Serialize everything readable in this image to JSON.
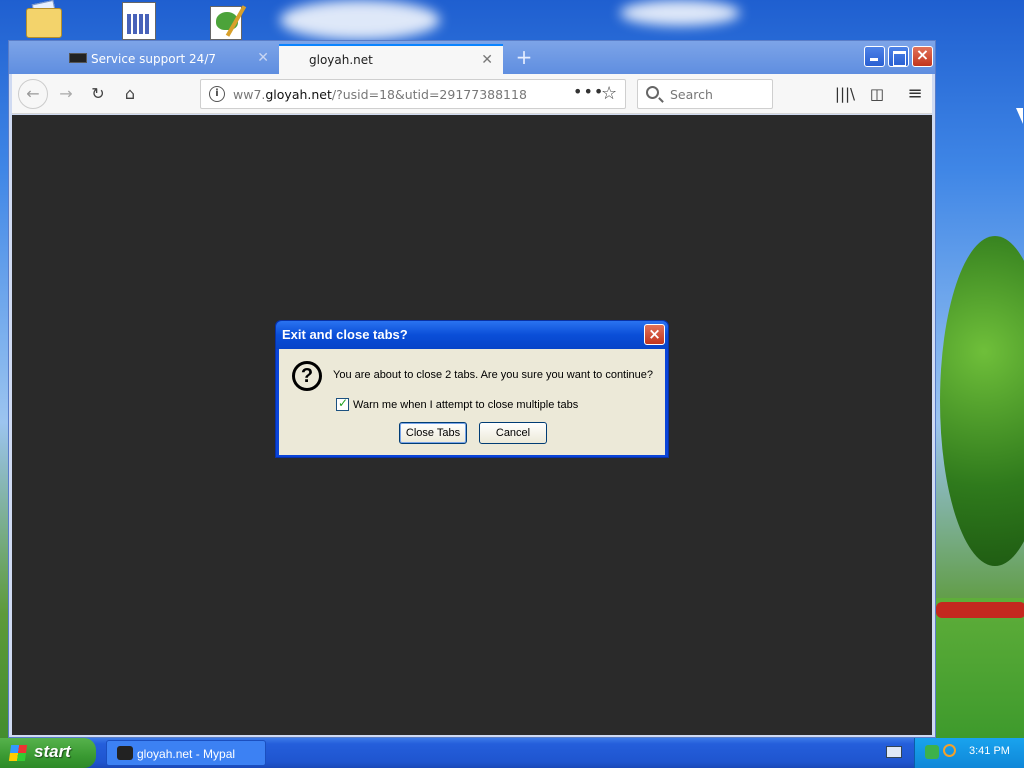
{
  "desktop": {
    "icons": [
      "folder-icon",
      "calculator-icon",
      "notepad-icon"
    ]
  },
  "browser": {
    "tabs": [
      {
        "label": "Service support 24/7",
        "active": false
      },
      {
        "label": "gloyah.net",
        "active": true
      }
    ],
    "close_glyph": "✕",
    "new_tab_glyph": "+",
    "url": {
      "prefix": "ww7.",
      "host": "gloyah.net",
      "path": "/?usid=18&utid=29177388118"
    },
    "search_placeholder": "Search"
  },
  "dialog": {
    "title": "Exit and close tabs?",
    "message": "You are about to close 2 tabs. Are you sure you want to continue?",
    "checkbox_label": "Warn me when I attempt to close multiple tabs",
    "checkbox_checked": true,
    "confirm_label": "Close Tabs",
    "cancel_label": "Cancel"
  },
  "taskbar": {
    "start_label": "start",
    "task_item_label": "gloyah.net - Mypal",
    "clock": "3:41 PM"
  },
  "colors": {
    "dialog_title_bg": "#0a4ed8",
    "dialog_body_bg": "#ece9d8",
    "content_bg": "#2a2a2a",
    "taskbar_bg": "#245edb",
    "start_bg": "#3a9a32"
  }
}
